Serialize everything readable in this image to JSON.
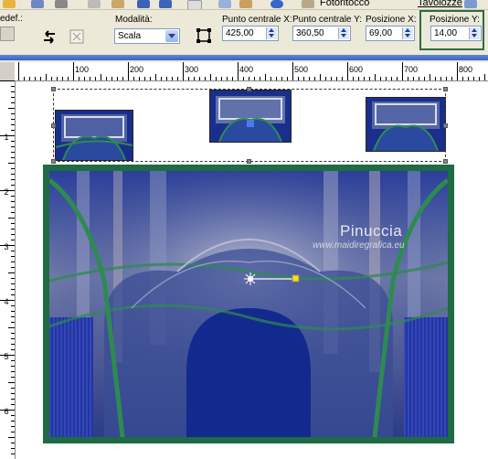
{
  "topbar": {
    "partial_left": "edef.:",
    "item1": "Fotoritocco",
    "item2": "Tavolozze"
  },
  "options": {
    "mode_label": "Modalità:",
    "mode_value": "Scala",
    "center_x_label": "Punto centrale X:",
    "center_x_value": "425,00",
    "center_y_label": "Punto centrale Y:",
    "center_y_value": "360,50",
    "pos_x_label": "Posizione X:",
    "pos_x_value": "69,00",
    "pos_y_label": "Posizione Y:",
    "pos_y_value": "14,00",
    "highlight_color": "#2e6b45"
  },
  "ruler": {
    "h_labels": [
      "100",
      "200",
      "300",
      "400",
      "500",
      "600",
      "700",
      "800"
    ],
    "v_labels": [
      "1",
      "2",
      "3",
      "4",
      "5",
      "6"
    ]
  },
  "watermark": {
    "title": "Pinuccia",
    "url": "www.maidiregrafica.eu"
  },
  "colors": {
    "frame_green": "#1f6b44",
    "deep_blue": "#1a2f8c",
    "ui_beige": "#ece9d8"
  },
  "icons": [
    "undo-icon",
    "redo-icon",
    "info-icon",
    "reset-icon",
    "pick-tool-icon",
    "deform-icon",
    "center-handle-icon"
  ]
}
